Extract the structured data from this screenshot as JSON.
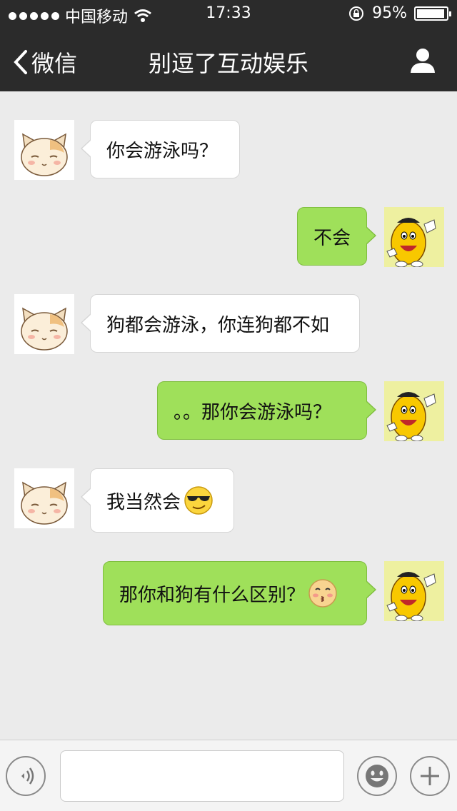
{
  "status_bar": {
    "carrier": "中国移动",
    "time": "17:33",
    "battery_text": "95%",
    "battery_level": 0.95,
    "signal_icon": "signal-dots-icon",
    "wifi_icon": "wifi-icon",
    "orientation_lock_icon": "rotation-lock-icon"
  },
  "nav": {
    "back_label": "微信",
    "title": "别逗了互动娱乐",
    "back_icon": "chevron-left-icon",
    "profile_icon": "person-icon"
  },
  "messages": [
    {
      "side": "left",
      "text": "你会游泳吗？",
      "avatar": "cat-avatar"
    },
    {
      "side": "right",
      "text": "不会",
      "avatar": "mascot-avatar"
    },
    {
      "side": "left",
      "text": "狗都会游泳，你连狗都不如",
      "avatar": "cat-avatar"
    },
    {
      "side": "right",
      "text": "。。那你会游泳吗？",
      "avatar": "mascot-avatar"
    },
    {
      "side": "left",
      "text": "我当然会",
      "emoji": "sunglasses-emoji",
      "avatar": "cat-avatar"
    },
    {
      "side": "right",
      "text": "那你和狗有什么区别？",
      "emoji": "kiss-emoji",
      "avatar": "mascot-avatar"
    }
  ],
  "input_bar": {
    "voice_icon": "voice-icon",
    "emoji_icon": "smiley-icon",
    "add_icon": "plus-icon",
    "input_value": ""
  },
  "colors": {
    "header_bg": "#2b2b2b",
    "chat_bg": "#ebebeb",
    "sent_bubble": "#9fe05a",
    "received_bubble": "#ffffff"
  }
}
